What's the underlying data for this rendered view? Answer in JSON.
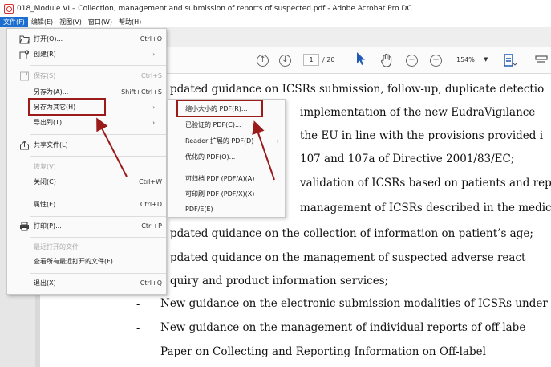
{
  "window": {
    "title": "018_Module VI – Collection, management and submission of reports of suspected.pdf - Adobe Acrobat Pro DC"
  },
  "menubar": [
    {
      "label": "文件(F)",
      "active": true
    },
    {
      "label": "编辑(E)"
    },
    {
      "label": "视图(V)"
    },
    {
      "label": "窗口(W)"
    },
    {
      "label": "帮助(H)"
    }
  ],
  "toolbar": {
    "page_current": "1",
    "page_total": "/ 20",
    "zoom": "154%",
    "zoom_caret": "▼"
  },
  "file_menu": {
    "open": {
      "label": "打开(O)...",
      "shortcut": "Ctrl+O"
    },
    "create": {
      "label": "创建(R)",
      "arrow": "›"
    },
    "save": {
      "label": "保存(S)",
      "shortcut": "Ctrl+S"
    },
    "save_as": {
      "label": "另存为(A)...",
      "shortcut": "Shift+Ctrl+S"
    },
    "save_as_other": {
      "label": "另存为其它(H)",
      "arrow": "›"
    },
    "export_to": {
      "label": "导出到(T)",
      "arrow": "›"
    },
    "share": {
      "label": "共享文件(L)"
    },
    "revert": {
      "label": "恢复(V)"
    },
    "close": {
      "label": "关闭(C)",
      "shortcut": "Ctrl+W"
    },
    "properties": {
      "label": "属性(E)...",
      "shortcut": "Ctrl+D"
    },
    "print": {
      "label": "打印(P)...",
      "shortcut": "Ctrl+P"
    },
    "recent_header": {
      "label": "最近打开的文件"
    },
    "view_all_recent": {
      "label": "查看所有最近打开的文件(F)..."
    },
    "exit": {
      "label": "退出(X)",
      "shortcut": "Ctrl+Q"
    }
  },
  "save_as_submenu": [
    {
      "label": "缩小大小的 PDF(R)...",
      "highlighted": true
    },
    {
      "label": "已验证的 PDF(C)..."
    },
    {
      "label": "Reader 扩展的 PDF(D)",
      "arrow": "›"
    },
    {
      "label": "优化的 PDF(O)..."
    },
    {
      "label": "可归档 PDF (PDF/A)(A)"
    },
    {
      "label": "可印刷 PDF (PDF/X)(X)"
    },
    {
      "label": "PDF/E(E)"
    }
  ],
  "document": {
    "lines": [
      "pdated guidance on ICSRs submission, follow-up, duplicate detectio",
      "implementation of the new EudraVigilance",
      "the EU in line with the provisions provided i",
      "107 and 107a of Directive 2001/83/EC;",
      "validation of ICSRs based on patients and rep",
      "management of ICSRs described in the medic",
      "pdated guidance on the collection of information on patient’s age;",
      "pdated guidance on the management of suspected adverse react",
      "quiry and product information services;",
      "New guidance on the electronic submission modalities of ICSRs under",
      "New guidance on the management of individual reports of off-labe",
      "Paper on Collecting and Reporting Information on Off-label"
    ],
    "bullet": "-"
  },
  "colors": {
    "menu_active": "#1c6fd0",
    "annotation": "#9b1b1b",
    "app_icon": "#d32f2f"
  }
}
